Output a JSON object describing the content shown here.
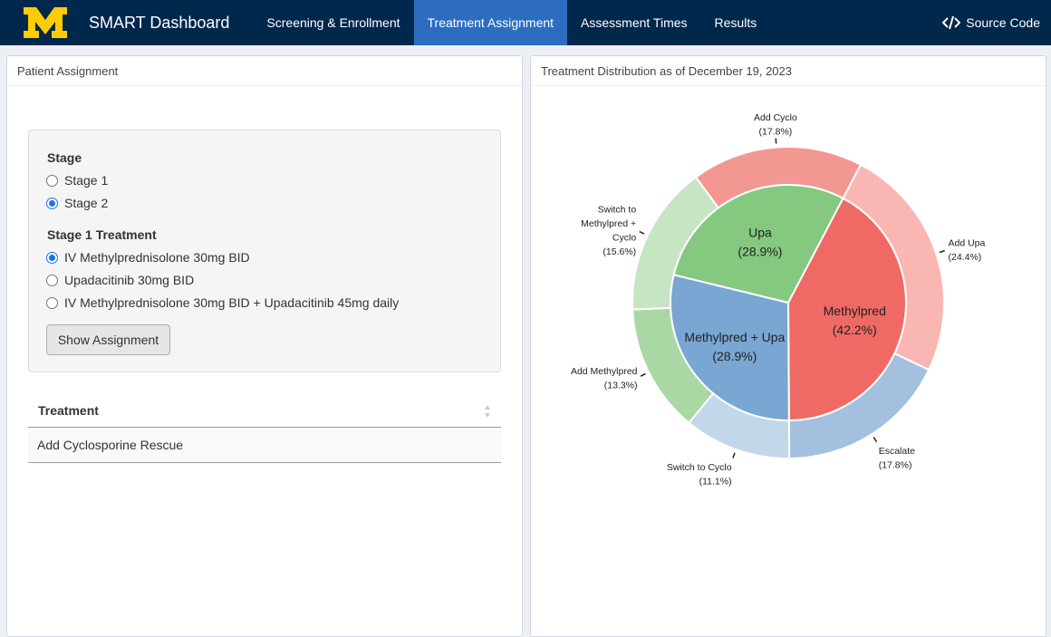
{
  "navbar": {
    "logo_text": "M",
    "title": "SMART Dashboard",
    "tabs": [
      {
        "label": "Screening & Enrollment",
        "active": false
      },
      {
        "label": "Treatment Assignment",
        "active": true
      },
      {
        "label": "Assessment Times",
        "active": false
      },
      {
        "label": "Results",
        "active": false
      }
    ],
    "source_code_label": "Source Code",
    "colors": {
      "navbar_bg": "#00274c",
      "active_tab_bg": "#2c6dc0",
      "logo": "#ffcb05"
    }
  },
  "left_panel": {
    "title": "Patient Assignment",
    "stage": {
      "label": "Stage",
      "options": [
        {
          "label": "Stage 1",
          "checked": false
        },
        {
          "label": "Stage 2",
          "checked": true
        }
      ]
    },
    "stage1_treatment": {
      "label": "Stage 1 Treatment",
      "options": [
        {
          "label": "IV Methylprednisolone 30mg BID",
          "checked": true
        },
        {
          "label": "Upadacitinib 30mg BID",
          "checked": false
        },
        {
          "label": "IV Methylprednisolone 30mg BID + Upadacitinib 45mg daily",
          "checked": false
        }
      ]
    },
    "show_button_label": "Show Assignment",
    "table": {
      "header": "Treatment",
      "rows": [
        "Add Cyclosporine Rescue"
      ]
    }
  },
  "right_panel": {
    "title": "Treatment Distribution as of December 19, 2023"
  },
  "chart_data": {
    "type": "pie",
    "subtype": "sunburst",
    "inner": [
      {
        "name": "Methylpred",
        "pct": "(42.2%)",
        "value": 42.2,
        "color": "#ef6a64"
      },
      {
        "name": "Methylpred + Upa",
        "pct": "(28.9%)",
        "value": 28.9,
        "color": "#79a6d2"
      },
      {
        "name": "Upa",
        "pct": "(28.9%)",
        "value": 28.9,
        "color": "#85c980"
      }
    ],
    "outer": [
      {
        "name": "Add Upa",
        "pct": "(24.4%)",
        "value": 24.4,
        "color": "#f9b6b3",
        "parent": "Methylpred"
      },
      {
        "name": "Escalate",
        "pct": "(17.8%)",
        "value": 17.8,
        "color": "#a3c0de",
        "parent": "Methylpred + Upa"
      },
      {
        "name": "Switch to Cyclo",
        "pct": "(11.1%)",
        "value": 11.1,
        "color": "#c3d7ea",
        "parent": "Methylpred + Upa"
      },
      {
        "name": "Add Methylpred",
        "pct": "(13.3%)",
        "value": 13.3,
        "color": "#a9d8a5",
        "parent": "Upa"
      },
      {
        "name": "Switch to Methylpred + Cyclo",
        "pct": "(15.6%)",
        "value": 15.6,
        "color": "#c6e5c3",
        "parent": "Upa"
      },
      {
        "name": "Add Cyclo",
        "pct": "(17.8%)",
        "value": 17.8,
        "color": "#f39793",
        "parent": "Methylpred"
      }
    ]
  }
}
